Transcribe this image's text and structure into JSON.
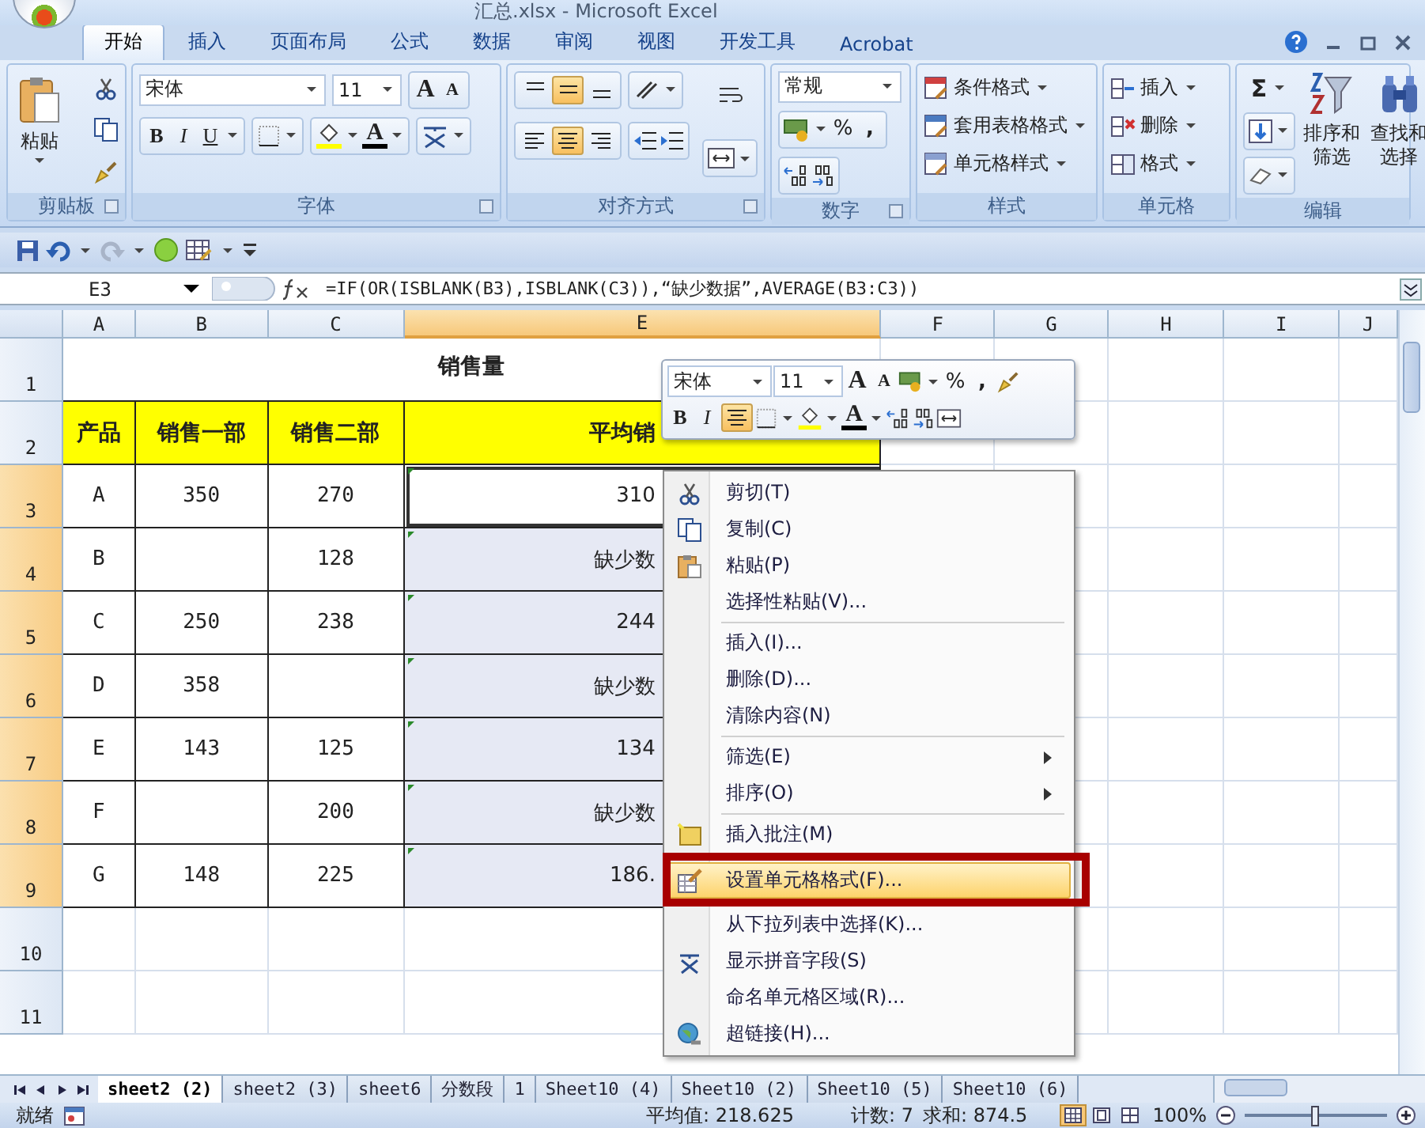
{
  "window": {
    "title": "汇总.xlsx - Microsoft Excel"
  },
  "ribbon_tabs": [
    {
      "label": "开始",
      "selected": true
    },
    {
      "label": "插入",
      "selected": false
    },
    {
      "label": "页面布局",
      "selected": false
    },
    {
      "label": "公式",
      "selected": false
    },
    {
      "label": "数据",
      "selected": false
    },
    {
      "label": "审阅",
      "selected": false
    },
    {
      "label": "视图",
      "selected": false
    },
    {
      "label": "开发工具",
      "selected": false
    },
    {
      "label": "Acrobat",
      "selected": false
    }
  ],
  "clipboard": {
    "paste": "粘贴",
    "title": "剪贴板"
  },
  "font": {
    "name": "宋体",
    "size": "11",
    "grow": "A",
    "shrink": "A",
    "bold": "B",
    "italic": "I",
    "underline": "U",
    "color_letter": "A",
    "title": "字体"
  },
  "alignment": {
    "vertical": [
      {
        "selected": false
      },
      {
        "selected": true
      },
      {
        "selected": false
      }
    ],
    "horizontal": [
      {
        "selected": false
      },
      {
        "selected": true
      },
      {
        "selected": false
      }
    ],
    "title": "对齐方式"
  },
  "number": {
    "format": "常规",
    "percent": "%",
    "comma": ",",
    "title": "数字"
  },
  "styles": {
    "items": [
      "条件格式",
      "套用表格格式",
      "单元格样式"
    ],
    "title": "样式"
  },
  "cells": {
    "items": [
      "插入",
      "删除",
      "格式"
    ],
    "title": "单元格"
  },
  "editing": {
    "sum": "Σ",
    "sort": "排序和筛选",
    "find": "查找和选择",
    "title": "编辑"
  },
  "name_box": "E3",
  "formula": "=IF(OR(ISBLANK(B3),ISBLANK(C3)),“缺少数据”,AVERAGE(B3:C3))",
  "columns": [
    {
      "label": "A",
      "selected": false
    },
    {
      "label": "B",
      "selected": false
    },
    {
      "label": "C",
      "selected": false
    },
    {
      "label": "E",
      "selected": true
    },
    {
      "label": "F",
      "selected": false
    },
    {
      "label": "G",
      "selected": false
    },
    {
      "label": "H",
      "selected": false
    },
    {
      "label": "I",
      "selected": false
    },
    {
      "label": "J",
      "selected": false
    }
  ],
  "rows": [
    {
      "label": "1",
      "kind": "title",
      "selected": false,
      "cells": [
        "销售量"
      ]
    },
    {
      "label": "2",
      "kind": "header",
      "selected": false,
      "cells": [
        "产品",
        "销售一部",
        "销售二部",
        "平均销"
      ]
    },
    {
      "label": "3",
      "kind": "data",
      "selected": true,
      "active": true,
      "cells": [
        "A",
        "350",
        "270",
        "310"
      ]
    },
    {
      "label": "4",
      "kind": "data",
      "selected": true,
      "active": false,
      "cells": [
        "B",
        null,
        "128",
        "缺少数"
      ]
    },
    {
      "label": "5",
      "kind": "data",
      "selected": true,
      "active": false,
      "cells": [
        "C",
        "250",
        "238",
        "244"
      ]
    },
    {
      "label": "6",
      "kind": "data",
      "selected": true,
      "active": false,
      "cells": [
        "D",
        "358",
        null,
        "缺少数"
      ]
    },
    {
      "label": "7",
      "kind": "data",
      "selected": true,
      "active": false,
      "cells": [
        "E",
        "143",
        "125",
        "134"
      ]
    },
    {
      "label": "8",
      "kind": "data",
      "selected": true,
      "active": false,
      "cells": [
        "F",
        null,
        "200",
        "缺少数"
      ]
    },
    {
      "label": "9",
      "kind": "data",
      "selected": true,
      "active": false,
      "cells": [
        "G",
        "148",
        "225",
        "186."
      ]
    },
    {
      "label": "10",
      "kind": "empty",
      "selected": false
    },
    {
      "label": "11",
      "kind": "empty",
      "selected": false
    }
  ],
  "mini_toolbar": {
    "font": "宋体",
    "size": "11",
    "grow": "A",
    "shrink": "A",
    "percent": "%",
    "comma": ",",
    "bold": "B",
    "italic": "I",
    "centered": true,
    "color_letter": "A"
  },
  "context_menu": [
    {
      "kind": "cut",
      "label": "剪切(T)",
      "submenu": false,
      "selected": false,
      "marked": false
    },
    {
      "kind": "copy",
      "label": "复制(C)",
      "submenu": false,
      "selected": false,
      "marked": false
    },
    {
      "kind": "paste",
      "label": "粘贴(P)",
      "submenu": false,
      "selected": false,
      "marked": false
    },
    {
      "kind": "plain",
      "label": "选择性粘贴(V)...",
      "submenu": false,
      "selected": false,
      "marked": false
    },
    {
      "kind": "separator"
    },
    {
      "kind": "plain",
      "label": "插入(I)...",
      "submenu": false,
      "selected": false,
      "marked": false
    },
    {
      "kind": "plain",
      "label": "删除(D)...",
      "submenu": false,
      "selected": false,
      "marked": false
    },
    {
      "kind": "plain",
      "label": "清除内容(N)",
      "submenu": false,
      "selected": false,
      "marked": false
    },
    {
      "kind": "separator"
    },
    {
      "kind": "plain",
      "label": "筛选(E)",
      "submenu": true,
      "selected": false,
      "marked": false
    },
    {
      "kind": "plain",
      "label": "排序(O)",
      "submenu": true,
      "selected": false,
      "marked": false
    },
    {
      "kind": "separator"
    },
    {
      "kind": "comment",
      "label": "插入批注(M)",
      "submenu": false,
      "selected": false,
      "marked": false
    },
    {
      "kind": "format",
      "label": "设置单元格格式(F)...",
      "submenu": false,
      "selected": true,
      "marked": true
    },
    {
      "kind": "plain",
      "label": "从下拉列表中选择(K)...",
      "submenu": false,
      "selected": false,
      "marked": false
    },
    {
      "kind": "pinyin",
      "label": "显示拼音字段(S)",
      "submenu": false,
      "selected": false,
      "marked": false
    },
    {
      "kind": "plain",
      "label": "命名单元格区域(R)...",
      "submenu": false,
      "selected": false,
      "marked": false
    },
    {
      "kind": "link",
      "label": "超链接(H)...",
      "submenu": false,
      "selected": false,
      "marked": false
    }
  ],
  "sheet_tabs": [
    {
      "label": "sheet2 (2)",
      "selected": true
    },
    {
      "label": "sheet2 (3)",
      "selected": false
    },
    {
      "label": "sheet6",
      "selected": false
    },
    {
      "label": "分数段",
      "selected": false
    },
    {
      "label": "1",
      "selected": false
    },
    {
      "label": "Sheet10 (4)",
      "selected": false
    },
    {
      "label": "Sheet10 (2)",
      "selected": false
    },
    {
      "label": "Sheet10 (5)",
      "selected": false
    },
    {
      "label": "Sheet10 (6)",
      "selected": false
    }
  ],
  "status_bar": {
    "state": "就绪",
    "average": "平均值: 218.625",
    "count": "计数: 7",
    "sum": "求和: 874.5",
    "zoom": "100%",
    "zoom_slider": {
      "level": 0.5
    },
    "views": [
      {
        "kind": "normal",
        "selected": true
      },
      {
        "kind": "layout",
        "selected": false
      },
      {
        "kind": "pagebreak",
        "selected": false
      }
    ]
  }
}
